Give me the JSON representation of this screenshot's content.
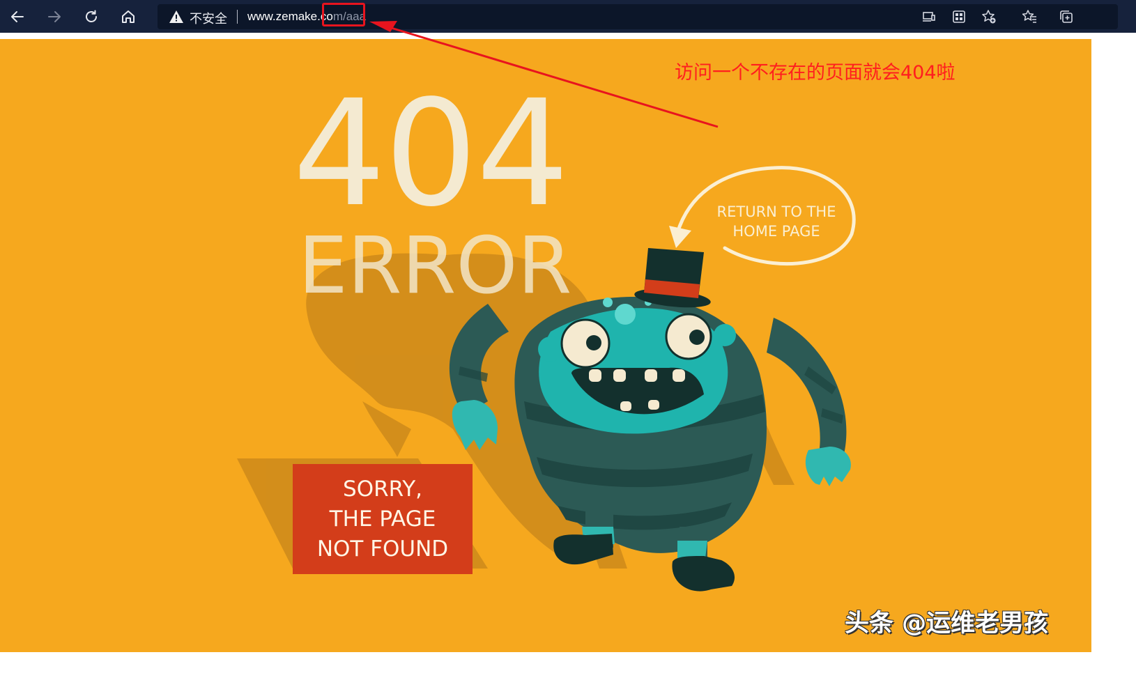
{
  "browser": {
    "nav": {
      "back_icon": "arrow-left-icon",
      "forward_icon": "arrow-right-icon",
      "refresh_icon": "refresh-icon",
      "home_icon": "home-icon"
    },
    "address": {
      "security_label": "不安全",
      "url_host": "www.zemake.co",
      "url_path": "m/aaa"
    },
    "toolbar_icons": [
      "device-icon",
      "apps-icon",
      "add-favorite-icon",
      "favorites-icon",
      "collections-icon"
    ]
  },
  "page": {
    "code": "404",
    "error": "ERROR",
    "return_line1": "RETURN TO THE",
    "return_line2": "HOME PAGE",
    "sorry_line1": "SORRY,",
    "sorry_line2": "THE PAGE",
    "sorry_line3": "NOT FOUND"
  },
  "annotation": {
    "note": "访问一个不存在的页面就会404啦"
  },
  "watermark": "头条 @运维老男孩",
  "colors": {
    "toolbar_bg": "#16223c",
    "page_bg": "#f6a81e",
    "annotation_red": "#ff1e1e",
    "sorry_red": "#d33d1a"
  }
}
